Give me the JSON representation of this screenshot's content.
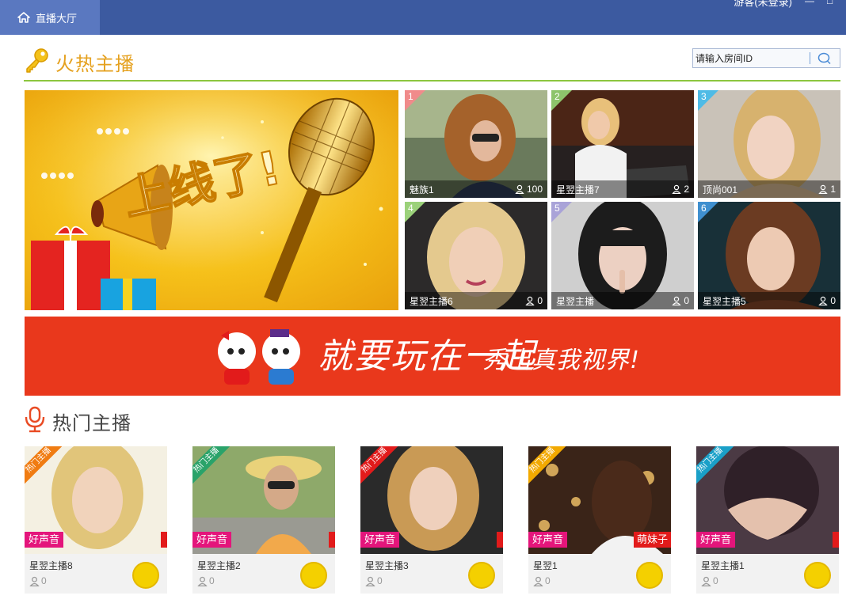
{
  "topbar": {
    "hall_label": "直播大厅",
    "guest_label": "游客(未登录)",
    "minimize": "—",
    "close": "□"
  },
  "section_live": {
    "title": "火热主播",
    "search": {
      "placeholder": "请输入房间ID",
      "value": ""
    }
  },
  "colors": {
    "topbar": "#3c5aa0",
    "accent_gold": "#e5a11f",
    "accent_green": "#8cc63f",
    "banner_red": "#e9381c",
    "tag_pink": "#e4157b"
  },
  "anchors": [
    {
      "rank": "1",
      "name": "魅族1",
      "viewers": "100",
      "rank_color": "#f08b8b"
    },
    {
      "rank": "2",
      "name": "星翌主播7",
      "viewers": "2",
      "rank_color": "#8dc46b"
    },
    {
      "rank": "3",
      "name": "顶尚001",
      "viewers": "1",
      "rank_color": "#4fbbe6"
    },
    {
      "rank": "4",
      "name": "星翌主播6",
      "viewers": "0",
      "rank_color": "#9bd17a"
    },
    {
      "rank": "5",
      "name": "星翌主播",
      "viewers": "0",
      "rank_color": "#a9a3d8"
    },
    {
      "rank": "6",
      "name": "星翌主播5",
      "viewers": "0",
      "rank_color": "#3f8fcf"
    }
  ],
  "promo_banner": {
    "slogan_main": "就要玩在一起",
    "slogan_sub": "秀出真我视界!"
  },
  "section_hot": {
    "title": "热门主播",
    "cards": [
      {
        "ribbon": "热门主播",
        "ribbon_color": "#f07c12",
        "tag": "好声音",
        "tag_right": "",
        "name": "星翌主播8",
        "viewers": "0"
      },
      {
        "ribbon": "热门主播",
        "ribbon_color": "#2aa36a",
        "tag": "好声音",
        "tag_right": "",
        "name": "星翌主播2",
        "viewers": "0"
      },
      {
        "ribbon": "热门主播",
        "ribbon_color": "#e21b1b",
        "tag": "好声音",
        "tag_right": "",
        "name": "星翌主播3",
        "viewers": "0"
      },
      {
        "ribbon": "热门主播",
        "ribbon_color": "#f2a900",
        "tag": "好声音",
        "tag_right": "萌妹子",
        "name": "星翌1",
        "viewers": "0"
      },
      {
        "ribbon": "热门主播",
        "ribbon_color": "#1aa0c8",
        "tag": "好声音",
        "tag_right": "",
        "name": "星翌主播1",
        "viewers": "0"
      }
    ]
  }
}
